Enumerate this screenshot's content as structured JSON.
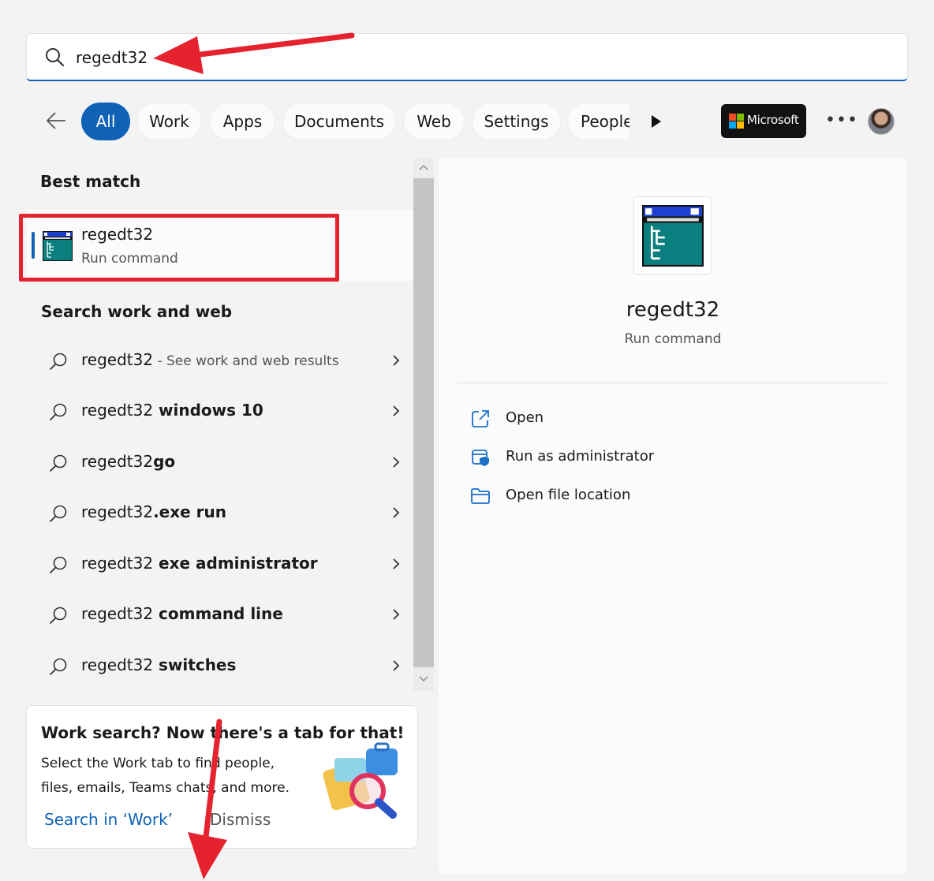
{
  "search": {
    "query": "regedt32"
  },
  "filters": {
    "back_label": "Back",
    "tabs": [
      {
        "label": "All",
        "active": true
      },
      {
        "label": "Work"
      },
      {
        "label": "Apps"
      },
      {
        "label": "Documents"
      },
      {
        "label": "Web"
      },
      {
        "label": "Settings"
      },
      {
        "label": "People"
      }
    ],
    "microsoft_badge": "Microsoft",
    "more_label": "•••"
  },
  "best_match": {
    "heading": "Best match",
    "item": {
      "title": "regedt32",
      "subtitle": "Run command"
    }
  },
  "web": {
    "heading": "Search work and web",
    "results": [
      {
        "prefix": "regedt32",
        "bold": "",
        "hint": " - See work and web results"
      },
      {
        "prefix": "regedt32",
        "bold": " windows 10",
        "hint": ""
      },
      {
        "prefix": "regedt32",
        "bold": "go",
        "hint": ""
      },
      {
        "prefix": "regedt32",
        "bold": ".exe run",
        "hint": ""
      },
      {
        "prefix": "regedt32",
        "bold": " exe administrator",
        "hint": ""
      },
      {
        "prefix": "regedt32",
        "bold": " command line",
        "hint": ""
      },
      {
        "prefix": "regedt32",
        "bold": " switches",
        "hint": ""
      }
    ]
  },
  "promo": {
    "title": "Work search? Now there's a tab for that!",
    "body": "Select the Work tab to find people, files, emails, Teams chats, and more.",
    "link": "Search in ‘Work’",
    "dismiss": "Dismiss"
  },
  "detail": {
    "title": "regedt32",
    "subtitle": "Run command",
    "actions": [
      {
        "label": "Open",
        "icon": "open-external-icon"
      },
      {
        "label": "Run as administrator",
        "icon": "shield-admin-icon"
      },
      {
        "label": "Open file location",
        "icon": "folder-icon"
      }
    ]
  },
  "colors": {
    "accent": "#0f62b6",
    "highlight_box": "#e5232f",
    "annotation_arrow": "#e5232f"
  }
}
